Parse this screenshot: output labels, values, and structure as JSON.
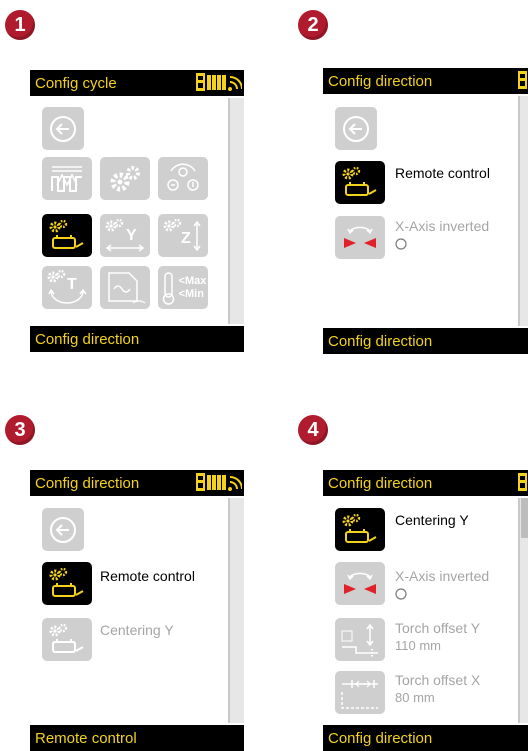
{
  "steps": [
    "1",
    "2",
    "3",
    "4"
  ],
  "colors": {
    "accent_yellow": "#f2d21c",
    "bar_black": "#000000",
    "disabled_gray": "#cfcfcf",
    "step_red": "#b01c2e",
    "arrow_red": "#e0202a"
  },
  "screen1": {
    "header": "Config cycle",
    "footer": "Config direction",
    "tiles": [
      {
        "icon": "back-arrow-icon"
      },
      {
        "icon": "pulse-wave-icon"
      },
      {
        "icon": "gears-icon"
      },
      {
        "icon": "remote-sequence-icon"
      },
      {
        "icon": "remote-control-icon"
      },
      {
        "icon": "axis-y-icon",
        "label": "Y"
      },
      {
        "icon": "axis-z-icon",
        "label": "Z"
      },
      {
        "icon": "axis-t-icon",
        "label": "T"
      },
      {
        "icon": "chart-icon"
      },
      {
        "icon": "thermometer-icon"
      }
    ],
    "max_label": "Max",
    "min_label": "Min"
  },
  "screen2": {
    "header": "Config direction",
    "footer": "Config direction",
    "items": [
      {
        "label": "Remote control"
      },
      {
        "label": "X-Axis inverted"
      }
    ]
  },
  "screen3": {
    "header": "Config direction",
    "footer": "Remote control",
    "items": [
      {
        "label": "Remote control"
      },
      {
        "label": "Centering Y"
      }
    ]
  },
  "screen4": {
    "header": "Config direction",
    "footer": "Config direction",
    "items": [
      {
        "label": "Centering Y"
      },
      {
        "label": "X-Axis inverted"
      },
      {
        "label": "Torch offset Y",
        "value": "110 mm"
      },
      {
        "label": "Torch offset X",
        "value": "80 mm"
      }
    ]
  }
}
